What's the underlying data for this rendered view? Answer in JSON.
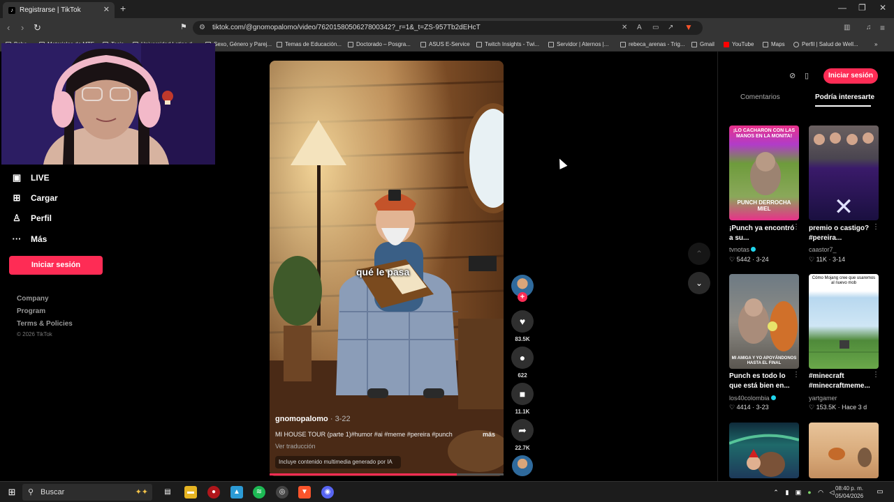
{
  "browser": {
    "tab_title": "Registrarse | TikTok",
    "new_tab": "+",
    "url": "tiktok.com/@gnomopalomo/video/7620158050627800342?_r=1&_t=ZS-957Tb2dEHcT",
    "bookmarks": [
      "Bebe",
      "Materiales de MTE",
      "Tesis",
      "Universidad Latina d...",
      "Sexo, Género y Parej...",
      "Temas de Educación...",
      "Doctorado – Posgra...",
      "ASUS E-Service",
      "Twitch Insights - Twi...",
      "Servidor | Aternos |...",
      "rebeca_arenas - Trig...",
      "Gmail",
      "YouTube",
      "Maps",
      "Perfil | Salud de Well..."
    ]
  },
  "left_nav": {
    "items": [
      {
        "label": "LIVE",
        "icon": "live-icon"
      },
      {
        "label": "Cargar",
        "icon": "upload-icon"
      },
      {
        "label": "Perfil",
        "icon": "profile-icon"
      },
      {
        "label": "Más",
        "icon": "more-icon"
      }
    ],
    "login_button": "Iniciar sesión",
    "footer_links": [
      "Company",
      "Program",
      "Terms & Policies"
    ],
    "copyright": "© 2026 TikTok"
  },
  "video": {
    "caption_overlay": "qué le pasa",
    "author": "gnomopalomo",
    "date": "· 3-22",
    "description": "MI HOUSE TOUR (parte 1)#humor #ai #meme #pereira #punch",
    "more": "más",
    "translate": "Ver traducción",
    "ai_label": "Incluye contenido multimedia generado por IA",
    "progress": 0.8
  },
  "actions": {
    "likes": "83.5K",
    "comments": "622",
    "saves": "11.1K",
    "shares": "22.7K"
  },
  "right_panel": {
    "login_button": "Iniciar sesión",
    "tab_comments": "Comentarios",
    "tab_interest": "Podría interesarte",
    "cards": [
      {
        "title": "¡Punch ya encontró a su...",
        "user": "tvnotas",
        "verified": true,
        "likes": "5442",
        "date": "3-24",
        "thumb_top": "¡LO CACHARON CON LAS MANOS EN LA MONITA!",
        "thumb_bottom": "PUNCH DERROCHA MIEL"
      },
      {
        "title": "premio o castigo? #pereira...",
        "user": "caastor7_",
        "verified": false,
        "likes": "11K",
        "date": "3-14",
        "thumb_top": "",
        "thumb_bottom": ""
      },
      {
        "title": "Punch es todo lo que está bien en...",
        "user": "los40colombia",
        "verified": true,
        "likes": "4414",
        "date": "3-23",
        "thumb_top": "",
        "thumb_bottom": "MI AMIGA Y YO APOYÁNDONOS HASTA EL FINAL"
      },
      {
        "title": "#minecraft #minecraftmeme...",
        "user": "yartgamer",
        "verified": false,
        "likes": "153.5K",
        "date": "Hace 3 d",
        "thumb_top": "Cómo Mojang cree que usaremos al nuevo mob",
        "thumb_bottom": ""
      }
    ]
  },
  "taskbar": {
    "search_placeholder": "Buscar",
    "time": "08:40 p. m.",
    "date": "05/04/2026"
  },
  "colors": {
    "accent": "#fe2c55",
    "verified": "#20d5ec"
  }
}
